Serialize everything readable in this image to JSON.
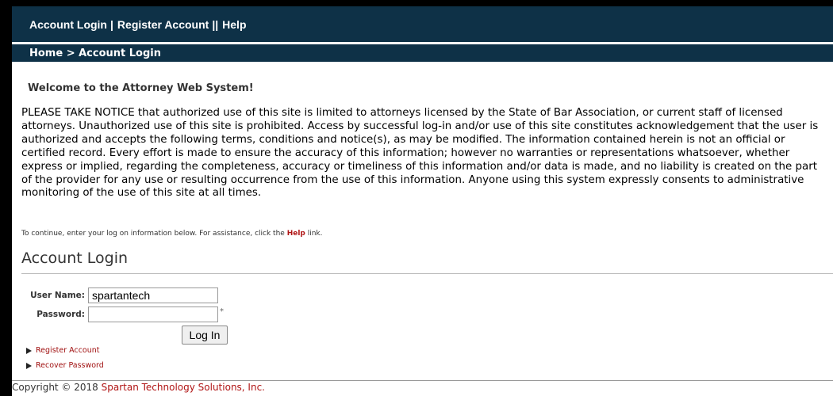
{
  "topnav": {
    "account_login": "Account Login",
    "sep1": "|",
    "register": "Register Account",
    "sep2": "||",
    "help": "Help"
  },
  "breadcrumb": "Home > Account Login",
  "welcome": "Welcome to the Attorney Web System!",
  "notice": "PLEASE TAKE NOTICE that authorized use of this site is limited to attorneys licensed by the State of Bar Association, or current staff of licensed attorneys. Unauthorized use of this site is prohibited. Access by successful log-in and/or use of this site constitutes acknowledgement that the user is authorized and accepts the following terms, conditions and notice(s), as may be modified. The information contained herein is not an official or certified record. Every effort is made to ensure the accuracy of this information; however no warranties or representations whatsoever, whether express or implied, regarding the completeness, accuracy or timeliness of this information and/or data is made, and no liability is created on the part of the provider for any use or resulting occurrence from the use of this information. Anyone using this system expressly consents to administrative monitoring of the use of this site at all times.",
  "hint": {
    "before": "To continue, enter your log on information below. For assistance, click the ",
    "help": "Help",
    "after": " link."
  },
  "login": {
    "title": "Account Login",
    "username_label": "User Name:",
    "username_value": "spartantech",
    "password_label": "Password:",
    "password_value": "",
    "required_mark": "*",
    "button": "Log In"
  },
  "links": {
    "register": "Register Account",
    "recover": "Recover Password"
  },
  "footer": {
    "prefix": "Copyright © 2018 ",
    "company": "Spartan Technology Solutions, Inc."
  },
  "colors": {
    "nav_bg": "#0e3147",
    "link_red": "#b01515"
  }
}
